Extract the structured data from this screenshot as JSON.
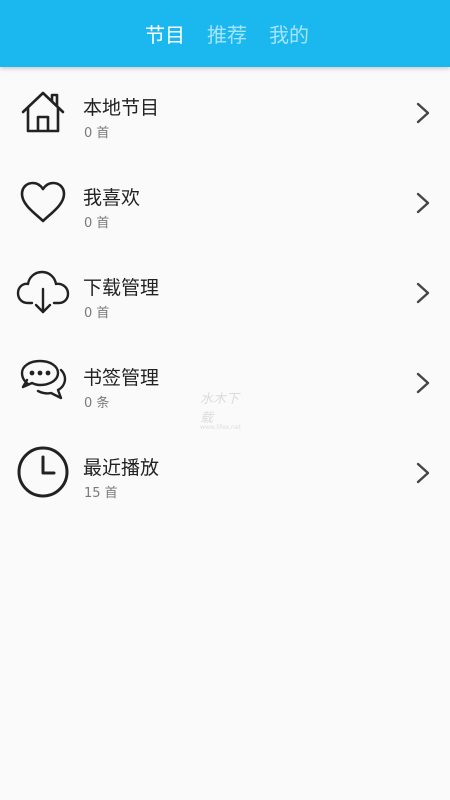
{
  "header": {
    "tabs": [
      {
        "label": "节目",
        "active": true
      },
      {
        "label": "推荐",
        "active": false
      },
      {
        "label": "我的",
        "active": false
      }
    ],
    "color": "#1ab8ef"
  },
  "items": [
    {
      "icon": "home-icon",
      "title": "本地节目",
      "subtitle": "0 首"
    },
    {
      "icon": "heart-icon",
      "title": "我喜欢",
      "subtitle": "0 首"
    },
    {
      "icon": "cloud-download-icon",
      "title": "下载管理",
      "subtitle": "0 首"
    },
    {
      "icon": "chat-bubbles-icon",
      "title": "书签管理",
      "subtitle": "0 条"
    },
    {
      "icon": "clock-icon",
      "title": "最近播放",
      "subtitle": "15 首"
    }
  ],
  "watermark": {
    "text": "水木下载",
    "sub": "www.5fex.net"
  }
}
